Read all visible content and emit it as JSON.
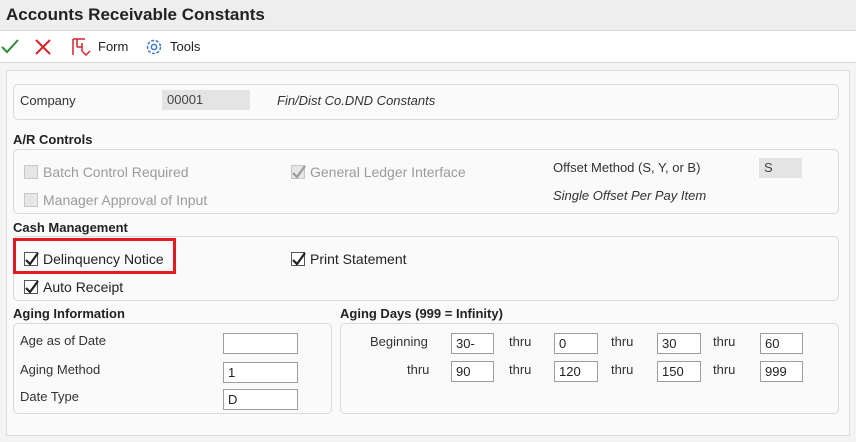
{
  "window": {
    "title": "Accounts Receivable Constants"
  },
  "toolbar": {
    "ok_icon": "checkmark-icon",
    "cancel_icon": "x-icon",
    "form_label": "Form",
    "form_icon": "form-icon",
    "tools_label": "Tools",
    "tools_icon": "gear-icon"
  },
  "company": {
    "label": "Company",
    "value": "00001",
    "description": "Fin/Dist Co.DND Constants"
  },
  "ar_controls": {
    "heading": "A/R Controls",
    "batch_control": {
      "label": "Batch Control Required",
      "checked": false,
      "disabled": true
    },
    "manager_approval": {
      "label": "Manager Approval of Input",
      "checked": false,
      "disabled": true
    },
    "gl_interface": {
      "label": "General Ledger Interface",
      "checked": true,
      "disabled": true
    },
    "offset_method": {
      "label": "Offset Method (S, Y, or B)",
      "value": "S",
      "description": "Single Offset Per Pay Item"
    }
  },
  "cash_management": {
    "heading": "Cash Management",
    "delinquency_notice": {
      "label": "Delinquency Notice",
      "checked": true
    },
    "print_statement": {
      "label": "Print Statement",
      "checked": true
    },
    "auto_receipt": {
      "label": "Auto Receipt",
      "checked": true
    }
  },
  "aging_information": {
    "heading": "Aging Information",
    "age_as_of_date": {
      "label": "Age as of Date",
      "value": ""
    },
    "aging_method": {
      "label": "Aging Method",
      "value": "1"
    },
    "date_type": {
      "label": "Date Type",
      "value": "D"
    }
  },
  "aging_days": {
    "heading": "Aging Days (999 = Infinity)",
    "beginning_label": "Beginning",
    "thru_label": "thru",
    "row1": [
      "30-",
      "0",
      "30",
      "60"
    ],
    "row2": [
      "90",
      "120",
      "150",
      "999"
    ]
  },
  "colors": {
    "highlight": "#e01b22",
    "ok": "#2e8b3a",
    "cancel": "#d9232d",
    "tools": "#3a78c9"
  }
}
